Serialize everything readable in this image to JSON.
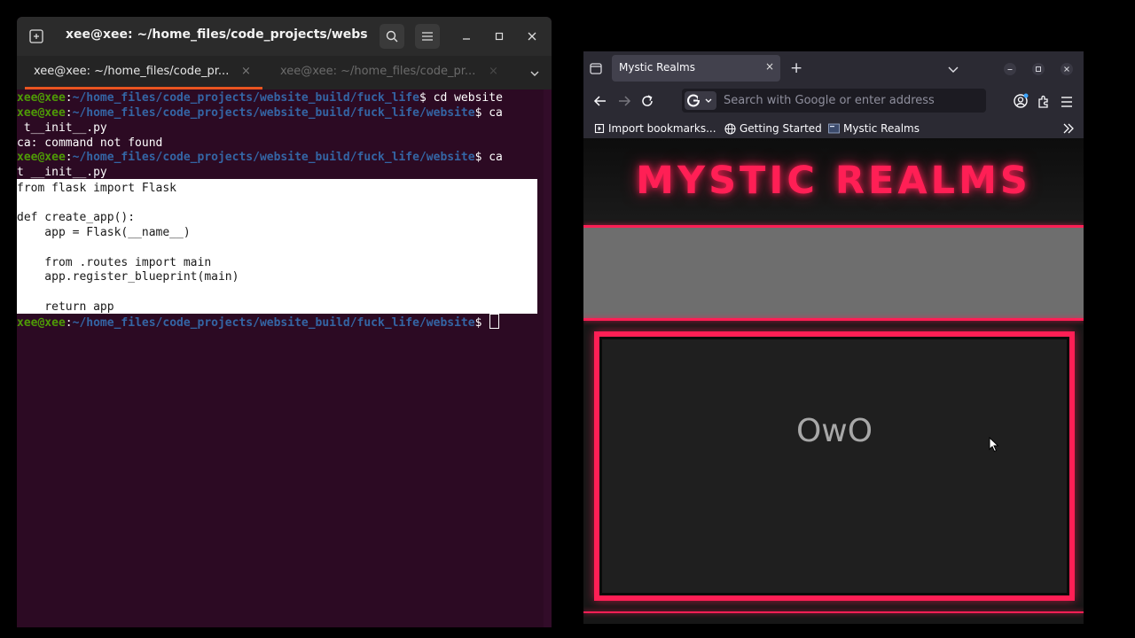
{
  "terminal": {
    "window_title": "xee@xee: ~/home_files/code_projects/website_...",
    "tabs": [
      {
        "label": "xee@xee: ~/home_files/code_pr...",
        "close": "×"
      },
      {
        "label": "xee@xee: ~/home_files/code_pr...",
        "close": "×"
      }
    ],
    "user_host": "xee@xee",
    "colon": ":",
    "path_build": "~/home_files/code_projects/website_build/fuck_life",
    "path_website": "~/home_files/code_projects/website_build/fuck_life/website",
    "dollar": "$",
    "lines": {
      "l1_cmd": " cd website",
      "l2_cmd": " ca",
      "l3": " t__init__.py",
      "l4": "ca: command not found",
      "l5_cmd": " ca",
      "l6": "t __init__.py"
    },
    "code": [
      "from flask import Flask",
      "",
      "def create_app():",
      "    app = Flask(__name__)",
      "",
      "    from .routes import main",
      "    app.register_blueprint(main)",
      "",
      "    return app"
    ]
  },
  "browser": {
    "tab_title": "Mystic Realms",
    "tab_close": "×",
    "new_tab": "+",
    "url_placeholder": "Search with Google or enter address",
    "bookmarks": [
      {
        "label": "Import bookmarks..."
      },
      {
        "label": "Getting Started"
      },
      {
        "label": "Mystic Realms"
      }
    ],
    "site": {
      "title": "MYSTIC REALMS",
      "card_text": "OwO"
    }
  },
  "colors": {
    "terminal_bg": "#2c0a23",
    "prompt_user": "#4e9a06",
    "prompt_path": "#3465a4",
    "accent_neon": "#ff1f55",
    "ubuntu_orange": "#e95420"
  }
}
